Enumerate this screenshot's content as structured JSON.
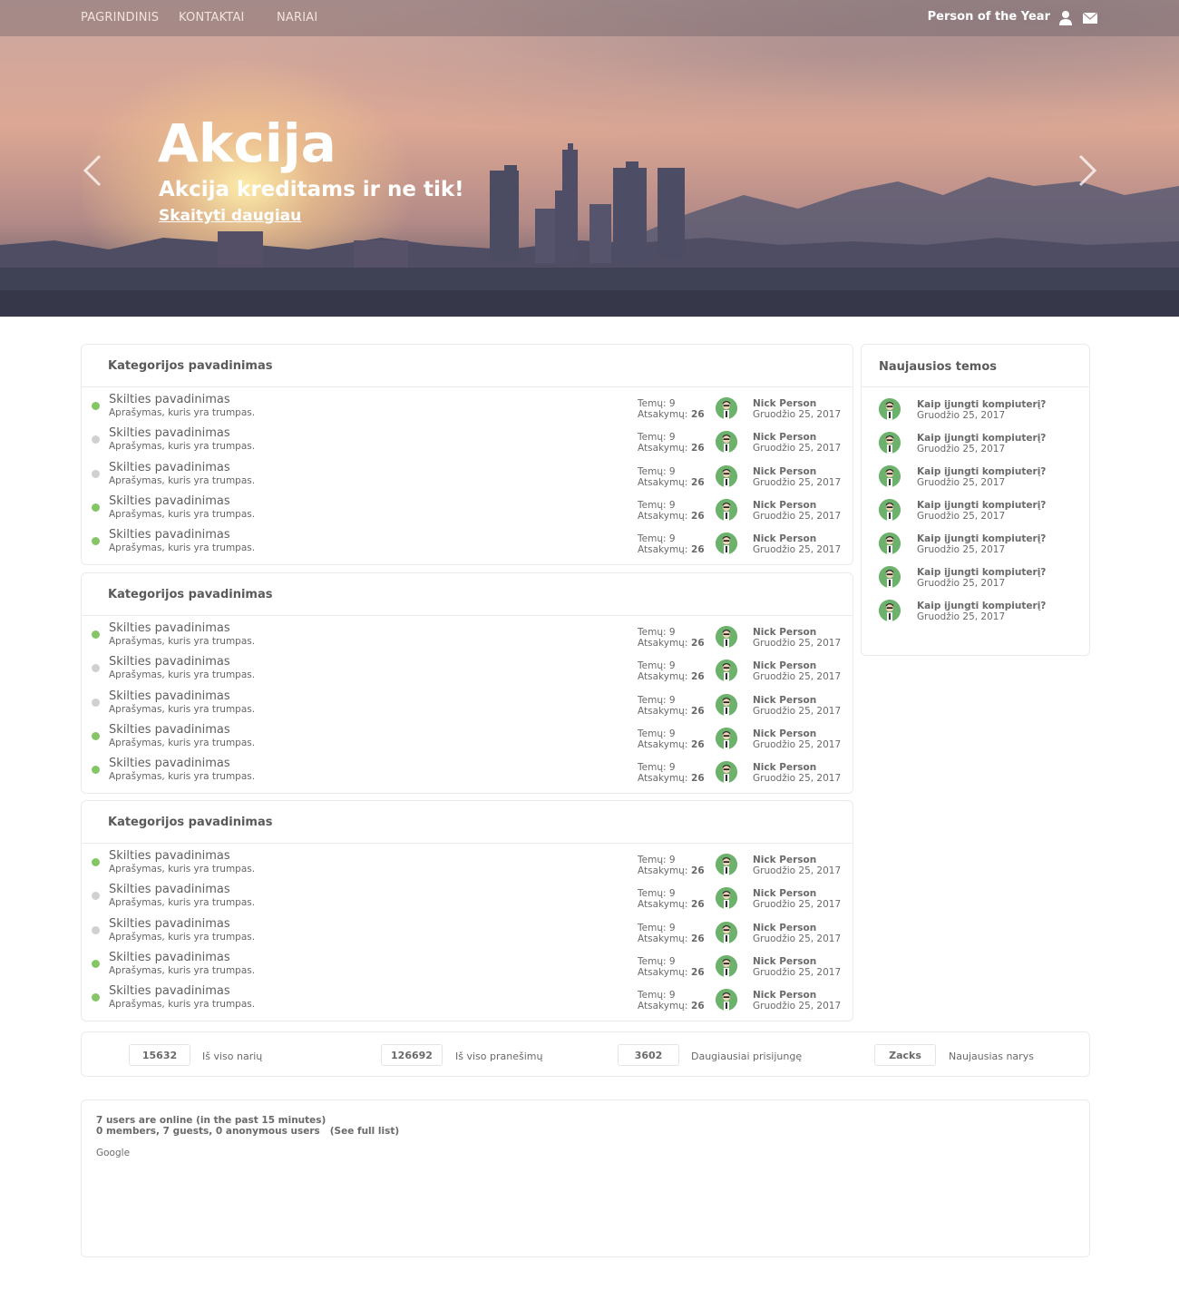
{
  "nav": {
    "links": [
      "PAGRINDINIS",
      "KONTAKTAI",
      "NARIAI"
    ],
    "user": "Person of the Year",
    "user_icon": "user-icon",
    "mail_icon": "mail-icon"
  },
  "hero": {
    "title": "Akcija",
    "subtitle": "Akcija kreditams ir ne tik!",
    "link": "Skaityti daugiau",
    "prev_icon": "chevron-left-icon",
    "next_icon": "chevron-right-icon"
  },
  "colors": {
    "online": "#84c566",
    "offline": "#d0d0d0",
    "avatar_bg": "#6cb26c"
  },
  "categories": [
    {
      "title": "Kategorijos pavadinimas",
      "forums": [
        {
          "title": "Skilties pavadinimas",
          "desc": "Aprašymas, kuris yra trumpas.",
          "status": "online",
          "topics_label": "Temų:",
          "topics": "9",
          "replies_label": "Atsakymų:",
          "replies": "26",
          "user": "Nick Person",
          "date": "Gruodžio 25, 2017"
        },
        {
          "title": "Skilties pavadinimas",
          "desc": "Aprašymas, kuris yra trumpas.",
          "status": "offline",
          "topics_label": "Temų:",
          "topics": "9",
          "replies_label": "Atsakymų:",
          "replies": "26",
          "user": "Nick Person",
          "date": "Gruodžio 25, 2017"
        },
        {
          "title": "Skilties pavadinimas",
          "desc": "Aprašymas, kuris yra trumpas.",
          "status": "offline",
          "topics_label": "Temų:",
          "topics": "9",
          "replies_label": "Atsakymų:",
          "replies": "26",
          "user": "Nick Person",
          "date": "Gruodžio 25, 2017"
        },
        {
          "title": "Skilties pavadinimas",
          "desc": "Aprašymas, kuris yra trumpas.",
          "status": "online",
          "topics_label": "Temų:",
          "topics": "9",
          "replies_label": "Atsakymų:",
          "replies": "26",
          "user": "Nick Person",
          "date": "Gruodžio 25, 2017"
        },
        {
          "title": "Skilties pavadinimas",
          "desc": "Aprašymas, kuris yra trumpas.",
          "status": "online",
          "topics_label": "Temų:",
          "topics": "9",
          "replies_label": "Atsakymų:",
          "replies": "26",
          "user": "Nick Person",
          "date": "Gruodžio 25, 2017"
        }
      ]
    },
    {
      "title": "Kategorijos pavadinimas",
      "forums": [
        {
          "title": "Skilties pavadinimas",
          "desc": "Aprašymas, kuris yra trumpas.",
          "status": "online",
          "topics_label": "Temų:",
          "topics": "9",
          "replies_label": "Atsakymų:",
          "replies": "26",
          "user": "Nick Person",
          "date": "Gruodžio 25, 2017"
        },
        {
          "title": "Skilties pavadinimas",
          "desc": "Aprašymas, kuris yra trumpas.",
          "status": "offline",
          "topics_label": "Temų:",
          "topics": "9",
          "replies_label": "Atsakymų:",
          "replies": "26",
          "user": "Nick Person",
          "date": "Gruodžio 25, 2017"
        },
        {
          "title": "Skilties pavadinimas",
          "desc": "Aprašymas, kuris yra trumpas.",
          "status": "offline",
          "topics_label": "Temų:",
          "topics": "9",
          "replies_label": "Atsakymų:",
          "replies": "26",
          "user": "Nick Person",
          "date": "Gruodžio 25, 2017"
        },
        {
          "title": "Skilties pavadinimas",
          "desc": "Aprašymas, kuris yra trumpas.",
          "status": "online",
          "topics_label": "Temų:",
          "topics": "9",
          "replies_label": "Atsakymų:",
          "replies": "26",
          "user": "Nick Person",
          "date": "Gruodžio 25, 2017"
        },
        {
          "title": "Skilties pavadinimas",
          "desc": "Aprašymas, kuris yra trumpas.",
          "status": "online",
          "topics_label": "Temų:",
          "topics": "9",
          "replies_label": "Atsakymų:",
          "replies": "26",
          "user": "Nick Person",
          "date": "Gruodžio 25, 2017"
        }
      ]
    },
    {
      "title": "Kategorijos pavadinimas",
      "forums": [
        {
          "title": "Skilties pavadinimas",
          "desc": "Aprašymas, kuris yra trumpas.",
          "status": "online",
          "topics_label": "Temų:",
          "topics": "9",
          "replies_label": "Atsakymų:",
          "replies": "26",
          "user": "Nick Person",
          "date": "Gruodžio 25, 2017"
        },
        {
          "title": "Skilties pavadinimas",
          "desc": "Aprašymas, kuris yra trumpas.",
          "status": "offline",
          "topics_label": "Temų:",
          "topics": "9",
          "replies_label": "Atsakymų:",
          "replies": "26",
          "user": "Nick Person",
          "date": "Gruodžio 25, 2017"
        },
        {
          "title": "Skilties pavadinimas",
          "desc": "Aprašymas, kuris yra trumpas.",
          "status": "offline",
          "topics_label": "Temų:",
          "topics": "9",
          "replies_label": "Atsakymų:",
          "replies": "26",
          "user": "Nick Person",
          "date": "Gruodžio 25, 2017"
        },
        {
          "title": "Skilties pavadinimas",
          "desc": "Aprašymas, kuris yra trumpas.",
          "status": "online",
          "topics_label": "Temų:",
          "topics": "9",
          "replies_label": "Atsakymų:",
          "replies": "26",
          "user": "Nick Person",
          "date": "Gruodžio 25, 2017"
        },
        {
          "title": "Skilties pavadinimas",
          "desc": "Aprašymas, kuris yra trumpas.",
          "status": "online",
          "topics_label": "Temų:",
          "topics": "9",
          "replies_label": "Atsakymų:",
          "replies": "26",
          "user": "Nick Person",
          "date": "Gruodžio 25, 2017"
        }
      ]
    }
  ],
  "sidebar": {
    "title": "Naujausios temos",
    "items": [
      {
        "title": "Kaip įjungti kompiuterį?",
        "date": "Gruodžio 25, 2017"
      },
      {
        "title": "Kaip įjungti kompiuterį?",
        "date": "Gruodžio 25, 2017"
      },
      {
        "title": "Kaip įjungti kompiuterį?",
        "date": "Gruodžio 25, 2017"
      },
      {
        "title": "Kaip įjungti kompiuterį?",
        "date": "Gruodžio 25, 2017"
      },
      {
        "title": "Kaip įjungti kompiuterį?",
        "date": "Gruodžio 25, 2017"
      },
      {
        "title": "Kaip įjungti kompiuterį?",
        "date": "Gruodžio 25, 2017"
      },
      {
        "title": "Kaip įjungti kompiuterį?",
        "date": "Gruodžio 25, 2017"
      }
    ]
  },
  "stats": [
    {
      "value": "15632",
      "label": "Iš viso narių"
    },
    {
      "value": "126692",
      "label": "Iš viso pranešimų"
    },
    {
      "value": "3602",
      "label": "Daugiausiai prisijungę"
    },
    {
      "value": "Zacks",
      "label": "Naujausias narys"
    }
  ],
  "online": {
    "line1": "7 users are online (in the past 15 minutes)",
    "line2": "0 members, 7 guests, 0 anonymous users",
    "full_list": "(See full list)",
    "bots": "Google"
  }
}
